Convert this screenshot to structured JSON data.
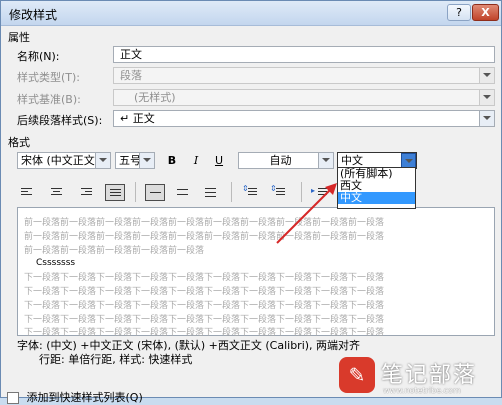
{
  "window": {
    "title": "修改样式",
    "help_label": "?",
    "close_label": "X"
  },
  "properties": {
    "section_label": "属性",
    "name_label": "名称(N):",
    "name_value": "正文",
    "style_type_label": "样式类型(T):",
    "style_type_value": "段落",
    "style_based_label": "样式基准(B):",
    "style_based_value": "(无样式)",
    "next_style_label": "后续段落样式(S):",
    "next_style_value": "↵ 正文"
  },
  "format": {
    "section_label": "格式",
    "font": "宋体 (中文正文",
    "size": "五号",
    "bold_label": "B",
    "italic_label": "I",
    "underline_label": "U",
    "color": "自动",
    "script": "中文",
    "script_options": [
      "(所有脚本)",
      "西文",
      "中文"
    ],
    "script_selected_index": 2
  },
  "preview": {
    "prev_lines": [
      "前一段落前一段落前一段落前一段落前一段落前一段落前一段落前一段落前一段落前一段落",
      "前一段落前一段落前一段落前一段落前一段落前一段落前一段落前一段落前一段落前一段落",
      "前一段落前一段落前一段落前一段落前一段落"
    ],
    "current": "Csssssss",
    "next_lines": [
      "下一段落下一段落下一段落下一段落下一段落下一段落下一段落下一段落下一段落下一段落",
      "下一段落下一段落下一段落下一段落下一段落下一段落下一段落下一段落下一段落下一段落",
      "下一段落下一段落下一段落下一段落下一段落下一段落下一段落下一段落下一段落下一段落",
      "下一段落下一段落下一段落下一段落下一段落下一段落下一段落下一段落下一段落下一段落",
      "下一段落下一段落下一段落下一段落下一段落下一段落下一段落下一段落下一段落下一段落"
    ]
  },
  "description": {
    "line1": "字体: (中文) +中文正文 (宋体), (默认) +西文正文 (Calibri), 两端对齐",
    "line2": "行距: 单倍行距, 样式: 快速样式"
  },
  "options": {
    "add_to_quick": "添加到快速样式列表(Q)"
  },
  "watermark": {
    "logo_char": "✎",
    "text": "笔记部落",
    "url": "www.notetribe.com"
  },
  "colors": {
    "selection": "#3399ff",
    "arrow": "#d62828"
  }
}
